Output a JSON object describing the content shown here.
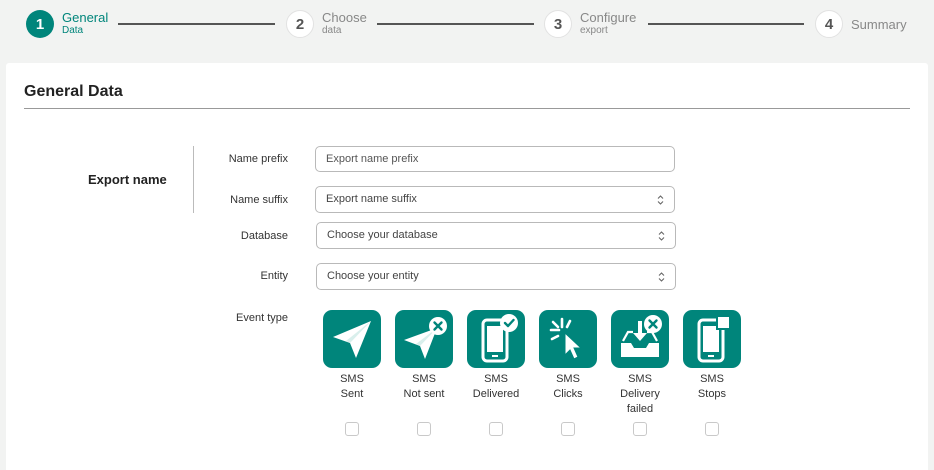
{
  "stepper": {
    "steps": [
      {
        "number": "1",
        "title": "General",
        "subtitle": "Data"
      },
      {
        "number": "2",
        "title": "Choose",
        "subtitle": "data"
      },
      {
        "number": "3",
        "title": "Configure",
        "subtitle": "export"
      },
      {
        "number": "4",
        "title": "Summary",
        "subtitle": ""
      }
    ],
    "active_step": 1
  },
  "card": {
    "title": "General Data",
    "section_label": "Export name",
    "fields": {
      "name_prefix": {
        "label": "Name prefix",
        "placeholder": "Export name prefix",
        "value": ""
      },
      "name_suffix": {
        "label": "Name suffix",
        "placeholder": "Export name suffix"
      },
      "database": {
        "label": "Database",
        "placeholder": "Choose your database"
      },
      "entity": {
        "label": "Entity",
        "placeholder": "Choose your entity"
      }
    },
    "event_type": {
      "label": "Event type",
      "options": [
        {
          "line1": "SMS",
          "line2": "Sent",
          "line3": "",
          "icon": "paper-plane-icon",
          "checked": false
        },
        {
          "line1": "SMS",
          "line2": "Not sent",
          "line3": "",
          "icon": "paper-plane-x-icon",
          "checked": false
        },
        {
          "line1": "SMS",
          "line2": "Delivered",
          "line3": "",
          "icon": "phone-check-icon",
          "checked": false
        },
        {
          "line1": "SMS",
          "line2": "Clicks",
          "line3": "",
          "icon": "cursor-click-icon",
          "checked": false
        },
        {
          "line1": "SMS",
          "line2": "Delivery",
          "line3": "failed",
          "icon": "inbox-x-icon",
          "checked": false
        },
        {
          "line1": "SMS",
          "line2": "Stops",
          "line3": "",
          "icon": "phone-stop-icon",
          "checked": false
        }
      ]
    }
  },
  "colors": {
    "accent": "#00857b",
    "background": "#f2f3f2",
    "card": "#ffffff"
  }
}
